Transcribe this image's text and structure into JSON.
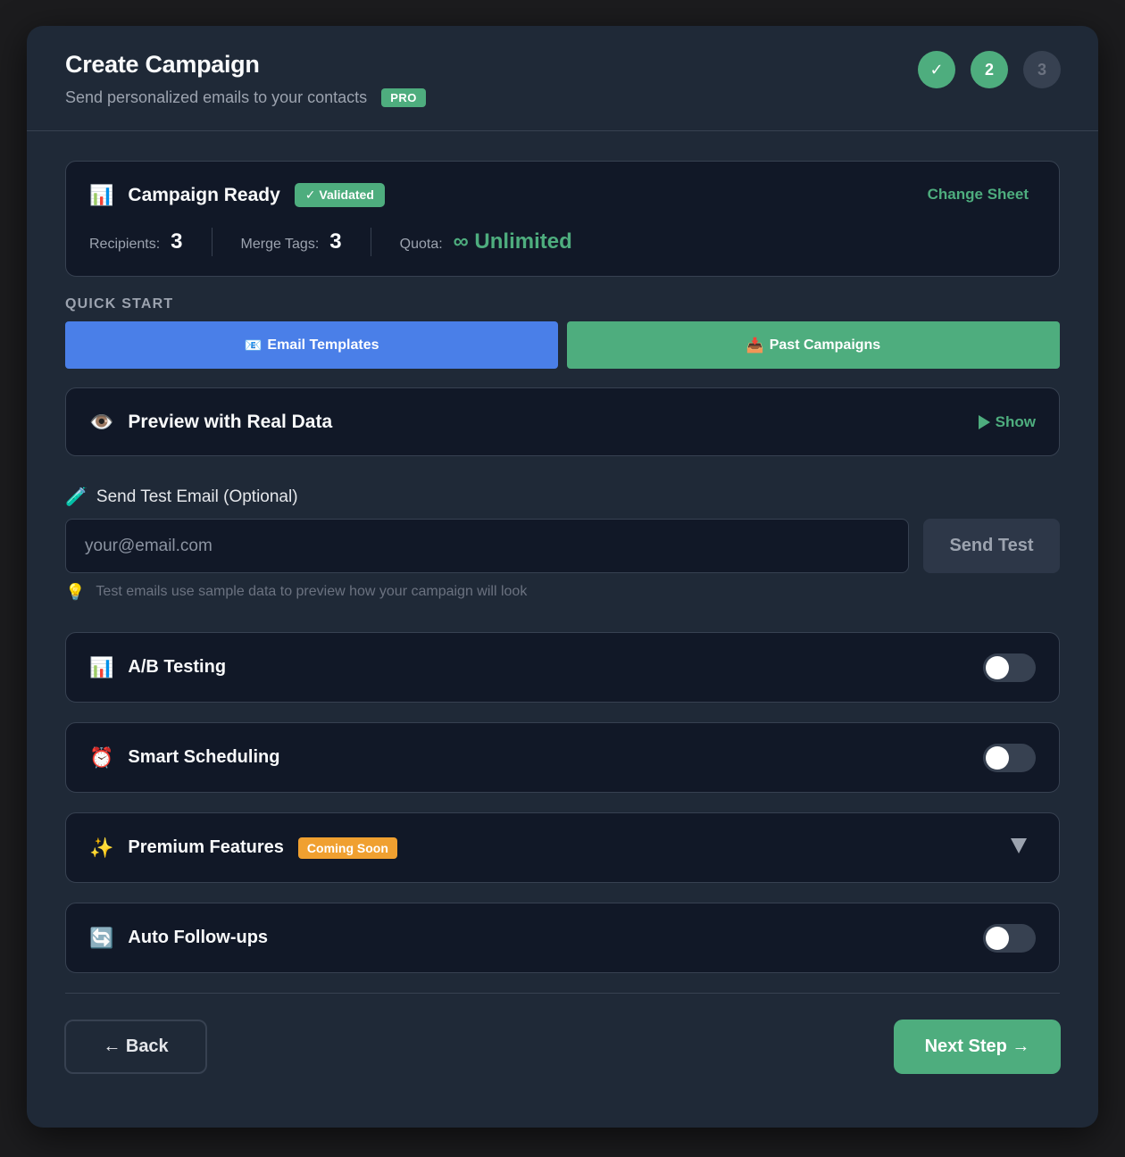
{
  "header": {
    "title": "Create Campaign",
    "subtitle": "Send personalized emails to your contacts",
    "badge": "PRO",
    "steps": [
      "✓",
      "2",
      "3"
    ]
  },
  "summary": {
    "icon": "📊",
    "title": "Campaign Ready",
    "status_badge": "✓ Validated",
    "change_link": "Change Sheet",
    "recipients_label": "Recipients:",
    "recipients_value": "3",
    "merge_tags_label": "Merge Tags:",
    "merge_tags_value": "3",
    "quota_label": "Quota:",
    "quota_value": "∞ Unlimited"
  },
  "quick_start": {
    "label": "QUICK START",
    "templates_icon": "📧",
    "templates_label": "Email Templates",
    "past_icon": "📥",
    "past_label": "Past Campaigns"
  },
  "preview": {
    "icon": "👁️",
    "title": "Preview with Real Data",
    "toggle_label": "Show"
  },
  "test_email": {
    "icon": "🧪",
    "label": "Send Test Email (Optional)",
    "placeholder": "your@email.com",
    "value": "",
    "button": "Send Test",
    "hint_icon": "💡",
    "hint": "Test emails use sample data to preview how your campaign will look"
  },
  "features": [
    {
      "icon": "📊",
      "title": "A/B Testing",
      "enabled": false
    },
    {
      "icon": "⏰",
      "title": "Smart Scheduling",
      "enabled": false
    },
    {
      "icon": "✨",
      "title": "Premium Features",
      "badge": "Coming Soon"
    },
    {
      "icon": "🔄",
      "title": "Auto Follow-ups",
      "enabled": false
    }
  ],
  "footer": {
    "back": "← Back",
    "next": "Next Step →"
  },
  "colors": {
    "accent_green": "#4ead7e",
    "accent_blue": "#4a7fe8",
    "badge_orange": "#f0a030",
    "modal_bg": "#1f2937",
    "card_bg": "#111827"
  }
}
